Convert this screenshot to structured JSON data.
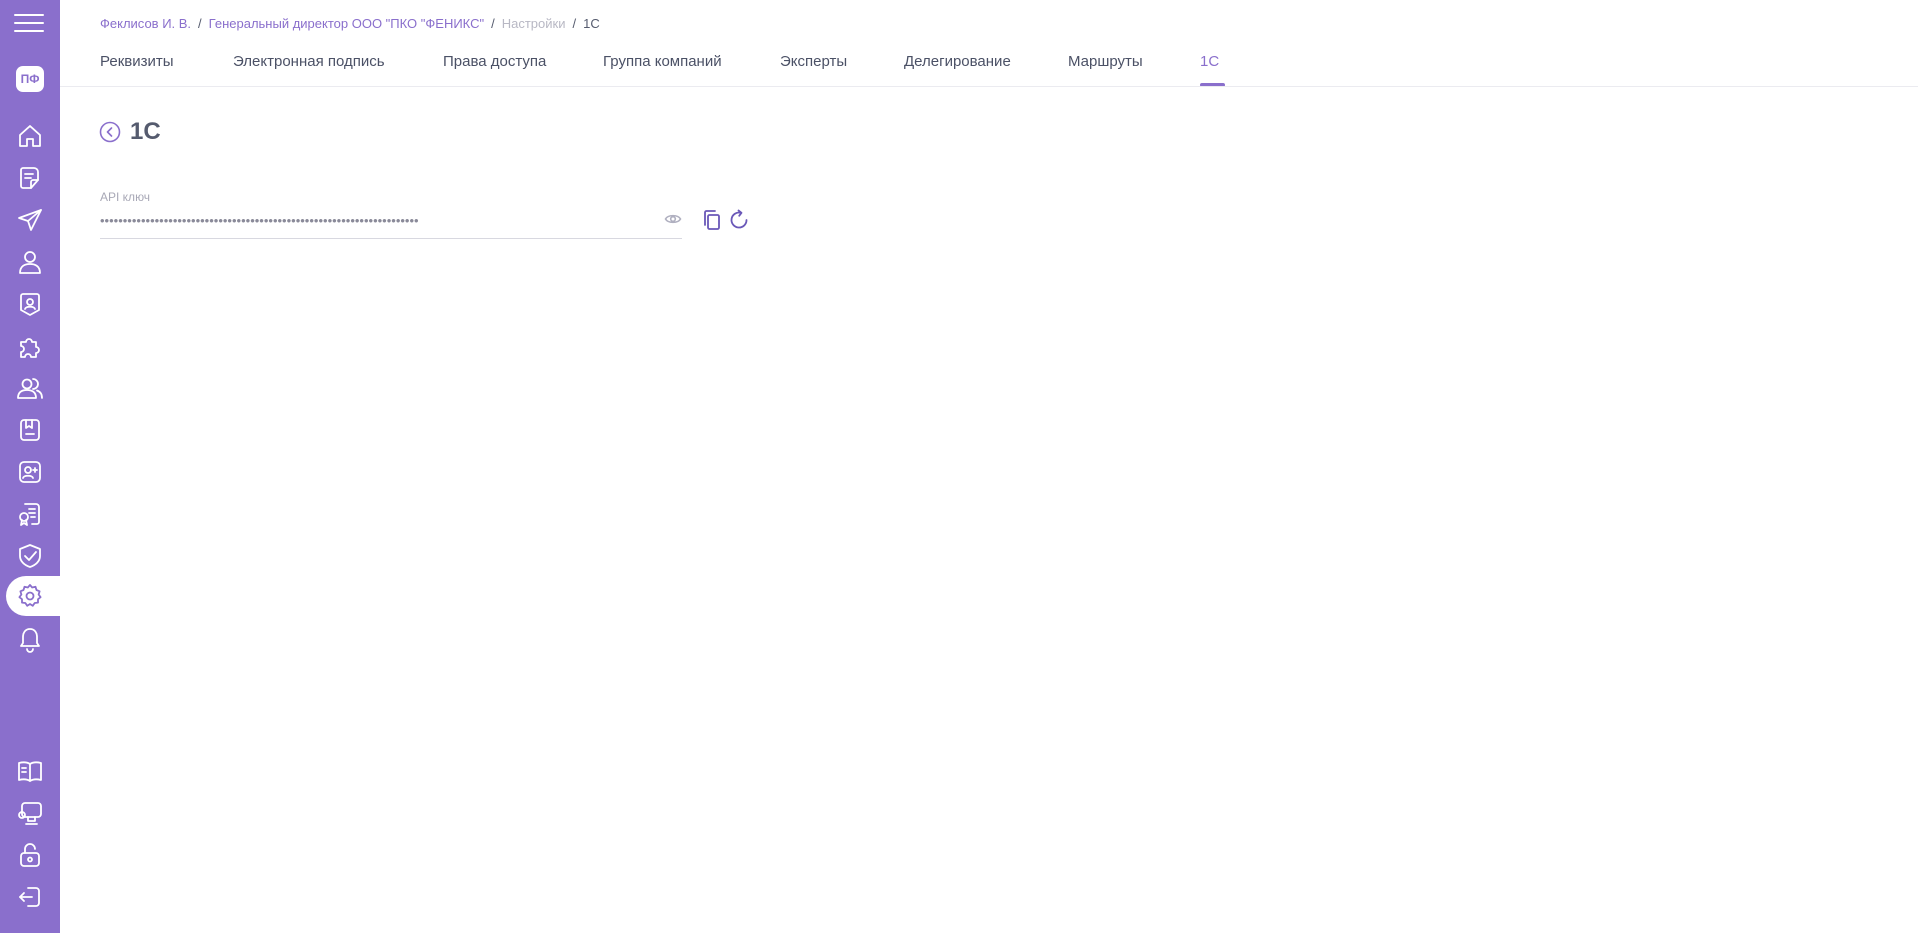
{
  "breadcrumb": {
    "user": "Феклисов И. В.",
    "company": "Генеральный директор ООО \"ПКО \"ФЕНИКС\"",
    "section": "Настройки",
    "current": "1С",
    "separator": "/"
  },
  "tabs": [
    {
      "label": "Реквизиты"
    },
    {
      "label": "Электронная подпись"
    },
    {
      "label": "Права доступа"
    },
    {
      "label": "Группа компаний"
    },
    {
      "label": "Эксперты"
    },
    {
      "label": "Делегирование"
    },
    {
      "label": "Маршруты"
    },
    {
      "label": "1С",
      "active": true
    }
  ],
  "page": {
    "title": "1С"
  },
  "api_key": {
    "label": "API ключ",
    "value": "••••••••••••••••••••••••••••••••••••••••••••••••••••••••••••••••••••••"
  },
  "sidebar": {
    "avatar_initials": "ПФ",
    "icons": [
      "menu-icon",
      "home-icon",
      "document-icon",
      "send-icon",
      "user-icon",
      "badge-icon",
      "puzzle-icon",
      "users-icon",
      "bookmark-icon",
      "add-user-icon",
      "certificate-icon",
      "shield-check-icon",
      "gear-icon",
      "bell-icon",
      "book-icon",
      "monitor-icon",
      "unlock-icon",
      "logout-icon"
    ]
  },
  "colors": {
    "accent": "#8a6fcc",
    "text": "#4b5166",
    "muted": "#b8b8c4"
  }
}
